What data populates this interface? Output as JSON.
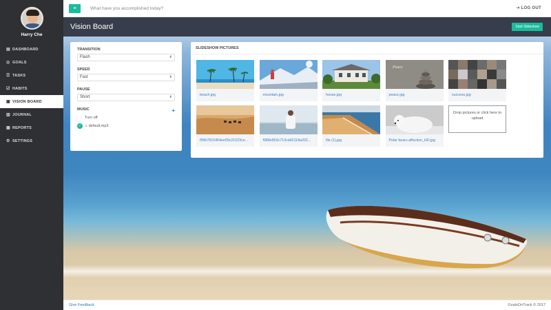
{
  "sidebar": {
    "user_name": "Harry Che",
    "items": [
      {
        "label": "DASHBOARD",
        "icon": "dashboard-icon",
        "glyph": "▤"
      },
      {
        "label": "GOALS",
        "icon": "target-icon",
        "glyph": "◎"
      },
      {
        "label": "TASKS",
        "icon": "list-icon",
        "glyph": "☰"
      },
      {
        "label": "HABITS",
        "icon": "check-square-icon",
        "glyph": "☑"
      },
      {
        "label": "VISION BOARD",
        "icon": "image-icon",
        "glyph": "▣"
      },
      {
        "label": "JOURNAL",
        "icon": "book-icon",
        "glyph": "▥"
      },
      {
        "label": "REPORTS",
        "icon": "bar-chart-icon",
        "glyph": "▦"
      },
      {
        "label": "SETTINGS",
        "icon": "gear-icon",
        "glyph": "⚙"
      }
    ],
    "active_index": 4
  },
  "topbar": {
    "menu_glyph": "≡",
    "accomplish_text": "What have you accomplished today?",
    "logout_label": "LOG OUT",
    "logout_glyph": "⇥"
  },
  "page": {
    "title": "Vision Board",
    "start_slideshow_label": "Start Slideshow"
  },
  "settings": {
    "transition_label": "TRANSITION",
    "transition_value": "Flash",
    "speed_label": "SPEED",
    "speed_value": "Fast",
    "pause_label": "PAUSE",
    "pause_value": "Short",
    "music_label": "MUSIC",
    "add_glyph": "+",
    "music_options": [
      {
        "label": "Turn off",
        "selected": false
      },
      {
        "label": "default.mp3",
        "selected": true
      }
    ]
  },
  "pictures": {
    "title": "SLIDESHOW PICTURES",
    "items": [
      {
        "caption": "beach.jpg",
        "kind": "beach"
      },
      {
        "caption": "mountain.jpg",
        "kind": "mountain"
      },
      {
        "caption": "house.jpg",
        "kind": "house"
      },
      {
        "caption": "peace.jpg",
        "kind": "peace"
      },
      {
        "caption": "success.jpg",
        "kind": "success"
      },
      {
        "caption": "f99b7815454ee59c21023ce...",
        "kind": "desert"
      },
      {
        "caption": "f988e853c713cdd2118a202...",
        "kind": "man-sea"
      },
      {
        "caption": "file (1).jpg",
        "kind": "coast"
      },
      {
        "caption": "Polar bears affection_HD.jpg",
        "kind": "bear"
      }
    ],
    "dropzone_text": "Drop pictures or click here to upload"
  },
  "footer": {
    "feedback_label": "Give Feedback",
    "copyright": "GoalsOnTrack © 2017"
  },
  "colors": {
    "accent": "#1abc9c",
    "sidebar_bg": "#2f3033",
    "titlebar_bg": "#373d4a",
    "link": "#3a7fc2"
  }
}
